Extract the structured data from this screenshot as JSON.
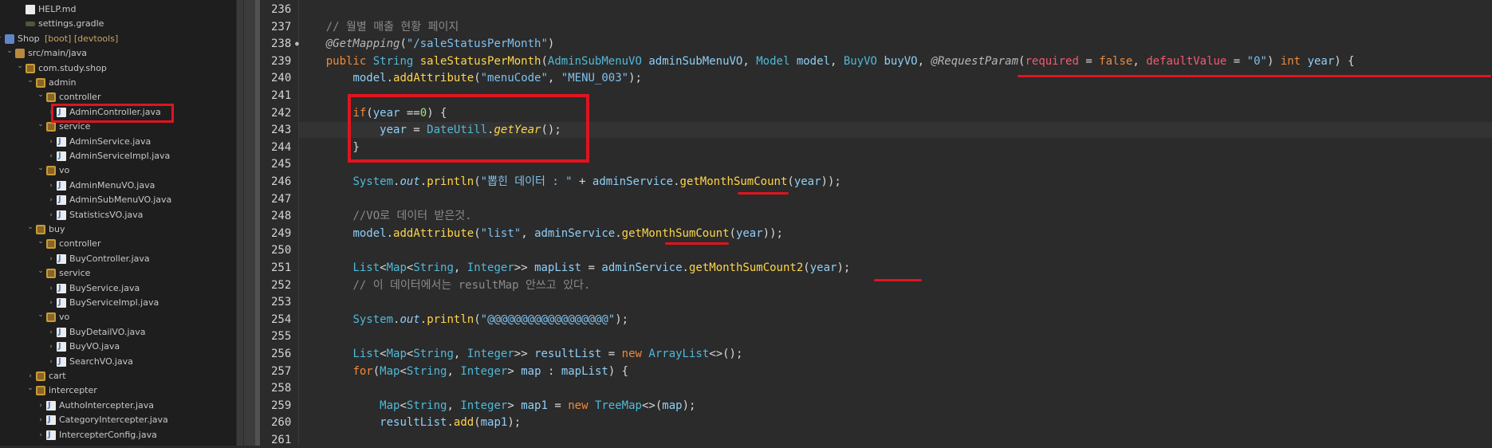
{
  "explorer": {
    "items": [
      {
        "label": "HELP.md",
        "kind": "file"
      },
      {
        "label": "settings.gradle",
        "kind": "gradle"
      },
      {
        "label": "Shop",
        "decor": "[boot] [devtools]",
        "kind": "project"
      },
      {
        "label": "src/main/java",
        "kind": "src"
      },
      {
        "label": "com.study.shop",
        "kind": "pkg"
      },
      {
        "label": "admin",
        "kind": "pkg"
      },
      {
        "label": "controller",
        "kind": "pkg"
      },
      {
        "label": "AdminController.java",
        "kind": "java"
      },
      {
        "label": "service",
        "kind": "pkg"
      },
      {
        "label": "AdminService.java",
        "kind": "java"
      },
      {
        "label": "AdminServiceImpl.java",
        "kind": "java"
      },
      {
        "label": "vo",
        "kind": "pkg"
      },
      {
        "label": "AdminMenuVO.java",
        "kind": "java"
      },
      {
        "label": "AdminSubMenuVO.java",
        "kind": "java"
      },
      {
        "label": "StatisticsVO.java",
        "kind": "java"
      },
      {
        "label": "buy",
        "kind": "pkg"
      },
      {
        "label": "controller",
        "kind": "pkg"
      },
      {
        "label": "BuyController.java",
        "kind": "java"
      },
      {
        "label": "service",
        "kind": "pkg"
      },
      {
        "label": "BuyService.java",
        "kind": "java"
      },
      {
        "label": "BuyServiceImpl.java",
        "kind": "java"
      },
      {
        "label": "vo",
        "kind": "pkg"
      },
      {
        "label": "BuyDetailVO.java",
        "kind": "java"
      },
      {
        "label": "BuyVO.java",
        "kind": "java"
      },
      {
        "label": "SearchVO.java",
        "kind": "java"
      },
      {
        "label": "cart",
        "kind": "pkg"
      },
      {
        "label": "intercepter",
        "kind": "pkg"
      },
      {
        "label": "AuthoIntercepter.java",
        "kind": "java"
      },
      {
        "label": "CategoryIntercepter.java",
        "kind": "java"
      },
      {
        "label": "IntercepterConfig.java",
        "kind": "java"
      }
    ]
  },
  "editor": {
    "line_numbers": [
      "236",
      "237",
      "238",
      "239",
      "240",
      "241",
      "242",
      "243",
      "244",
      "245",
      "246",
      "247",
      "248",
      "249",
      "250",
      "251",
      "252",
      "253",
      "254",
      "255",
      "256",
      "257",
      "258",
      "259",
      "260",
      "261"
    ],
    "code": [
      {
        "t": ""
      },
      {
        "t": "    // 월별 매출 현황 페이지"
      },
      {
        "t": "    @GetMapping(\"/saleStatusPerMonth\")"
      },
      {
        "t": "    public String saleStatusPerMonth(AdminSubMenuVO adminSubMenuVO, Model model, BuyVO buyVO, @RequestParam(required = false, defaultValue = \"0\") int year) {"
      },
      {
        "t": "        model.addAttribute(\"menuCode\", \"MENU_003\");"
      },
      {
        "t": ""
      },
      {
        "t": "        if(year ==0) {"
      },
      {
        "t": "            year = DateUtill.getYear();"
      },
      {
        "t": "        }"
      },
      {
        "t": ""
      },
      {
        "t": "        System.out.println(\"뽑힌 데이터 : \" + adminService.getMonthSumCount(year));"
      },
      {
        "t": ""
      },
      {
        "t": "        //VO로 데이터 받은것."
      },
      {
        "t": "        model.addAttribute(\"list\", adminService.getMonthSumCount(year));"
      },
      {
        "t": ""
      },
      {
        "t": "        List<Map<String, Integer>> mapList = adminService.getMonthSumCount2(year);"
      },
      {
        "t": "        // 이 데이터에서는 resultMap 안쓰고 있다."
      },
      {
        "t": ""
      },
      {
        "t": "        System.out.println(\"@@@@@@@@@@@@@@@@@@\");"
      },
      {
        "t": ""
      },
      {
        "t": "        List<Map<String, Integer>> resultList = new ArrayList<>();"
      },
      {
        "t": "        for(Map<String, Integer> map : mapList) {"
      },
      {
        "t": ""
      },
      {
        "t": "            Map<String, Integer> map1 = new TreeMap<>(map);"
      },
      {
        "t": "            resultList.add(map1);"
      },
      {
        "t": ""
      }
    ]
  },
  "colors": {
    "annotation_red": "#e0141e"
  }
}
